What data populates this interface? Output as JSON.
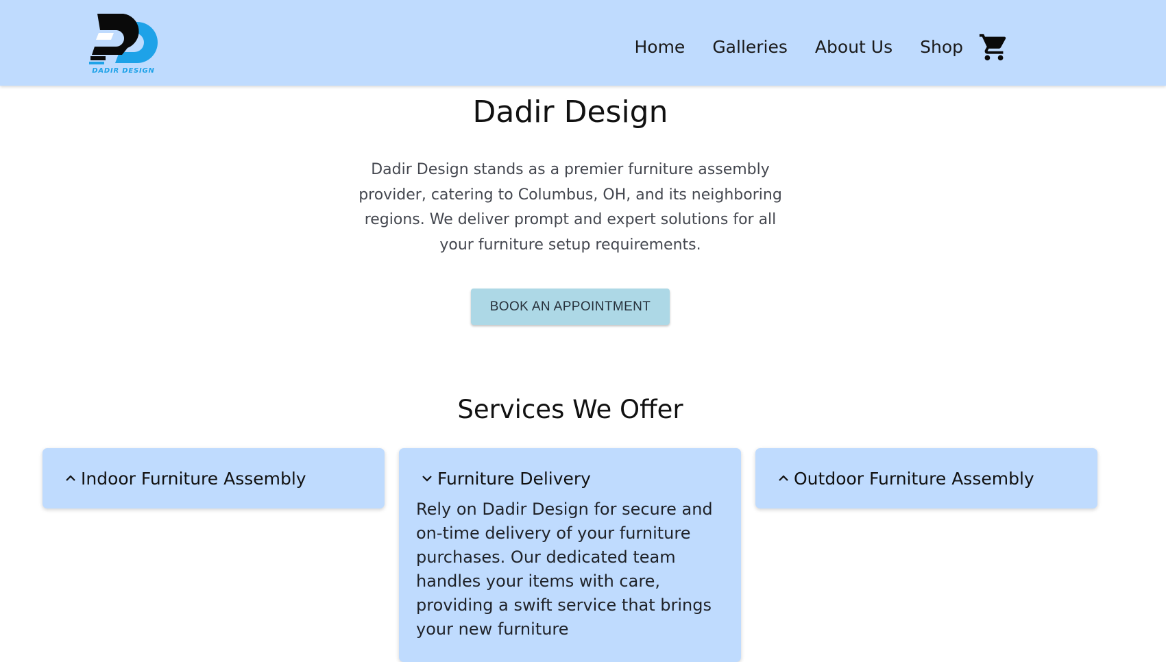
{
  "header": {
    "logo_text": "DADIR DESIGN",
    "nav": [
      {
        "label": "Home"
      },
      {
        "label": "Galleries"
      },
      {
        "label": "About Us"
      },
      {
        "label": "Shop"
      }
    ],
    "cart_icon": "shopping-cart-icon"
  },
  "hero": {
    "title": "Dadir Design",
    "description": "Dadir Design stands as a premier furniture assembly provider, catering to Columbus, OH, and its neighboring regions. We deliver prompt and expert solutions for all your furniture setup requirements.",
    "cta_label": "BOOK AN APPOINTMENT"
  },
  "services": {
    "title": "Services We Offer",
    "cards": [
      {
        "title": "Indoor Furniture Assembly",
        "expanded": false,
        "icon": "chevron-up-icon"
      },
      {
        "title": "Furniture Delivery",
        "expanded": true,
        "icon": "chevron-down-icon",
        "body": "Rely on Dadir Design for secure and on-time delivery of your furniture purchases. Our dedicated team handles your items with care, providing a swift service that brings your new furniture"
      },
      {
        "title": "Outdoor Furniture Assembly",
        "expanded": false,
        "icon": "chevron-up-icon"
      }
    ]
  },
  "colors": {
    "header_bg": "#bfdbfe",
    "card_bg": "#bfdbfe",
    "cta_bg": "#add8e6",
    "logo_blue": "#1ea2e8",
    "logo_dark": "#0a0a0a"
  }
}
